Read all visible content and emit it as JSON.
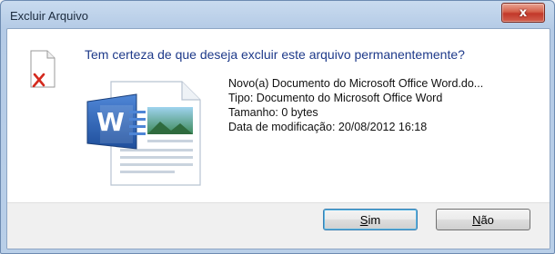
{
  "window": {
    "title": "Excluir Arquivo",
    "close_glyph": "x"
  },
  "dialog": {
    "question": "Tem certeza de que deseja excluir este arquivo permanentemente?",
    "file": {
      "name": "Novo(a) Documento do Microsoft Office Word.do...",
      "type": "Tipo: Documento do Microsoft Office Word",
      "size": "Tamanho: 0 bytes",
      "modified": "Data de modificação: 20/08/2012 16:18"
    },
    "icons": {
      "warning": "delete-file-icon",
      "document": "word-document-icon"
    }
  },
  "buttons": {
    "yes": {
      "mnemonic": "S",
      "rest": "im"
    },
    "no": {
      "mnemonic": "N",
      "rest": "ão"
    }
  },
  "colors": {
    "question_text": "#1e3a8a",
    "close_button": "#c2382a",
    "red_x": "#d42a1e",
    "word_blue": "#2b579a"
  }
}
